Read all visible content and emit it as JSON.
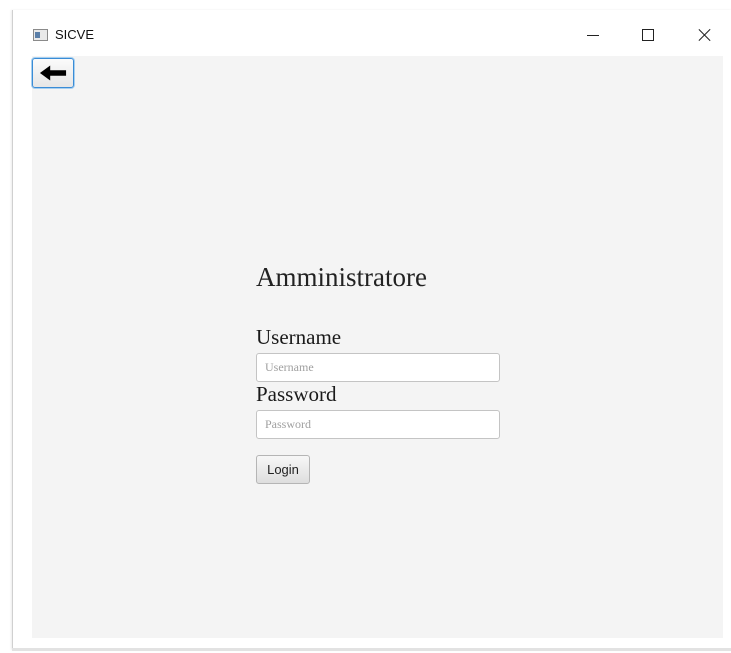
{
  "window": {
    "title": "SICVE",
    "controls": [
      "minimize-icon",
      "maximize-icon",
      "close-icon"
    ]
  },
  "navigation": {
    "back_icon": "arrow-left-icon"
  },
  "login": {
    "heading": "Amministratore",
    "username_label": "Username",
    "username_placeholder": "Username",
    "username_value": "",
    "password_label": "Password",
    "password_placeholder": "Password",
    "password_value": "",
    "login_button": "Login"
  },
  "colors": {
    "background": "#f4f4f4",
    "focus_accent": "#3a8cd6"
  }
}
